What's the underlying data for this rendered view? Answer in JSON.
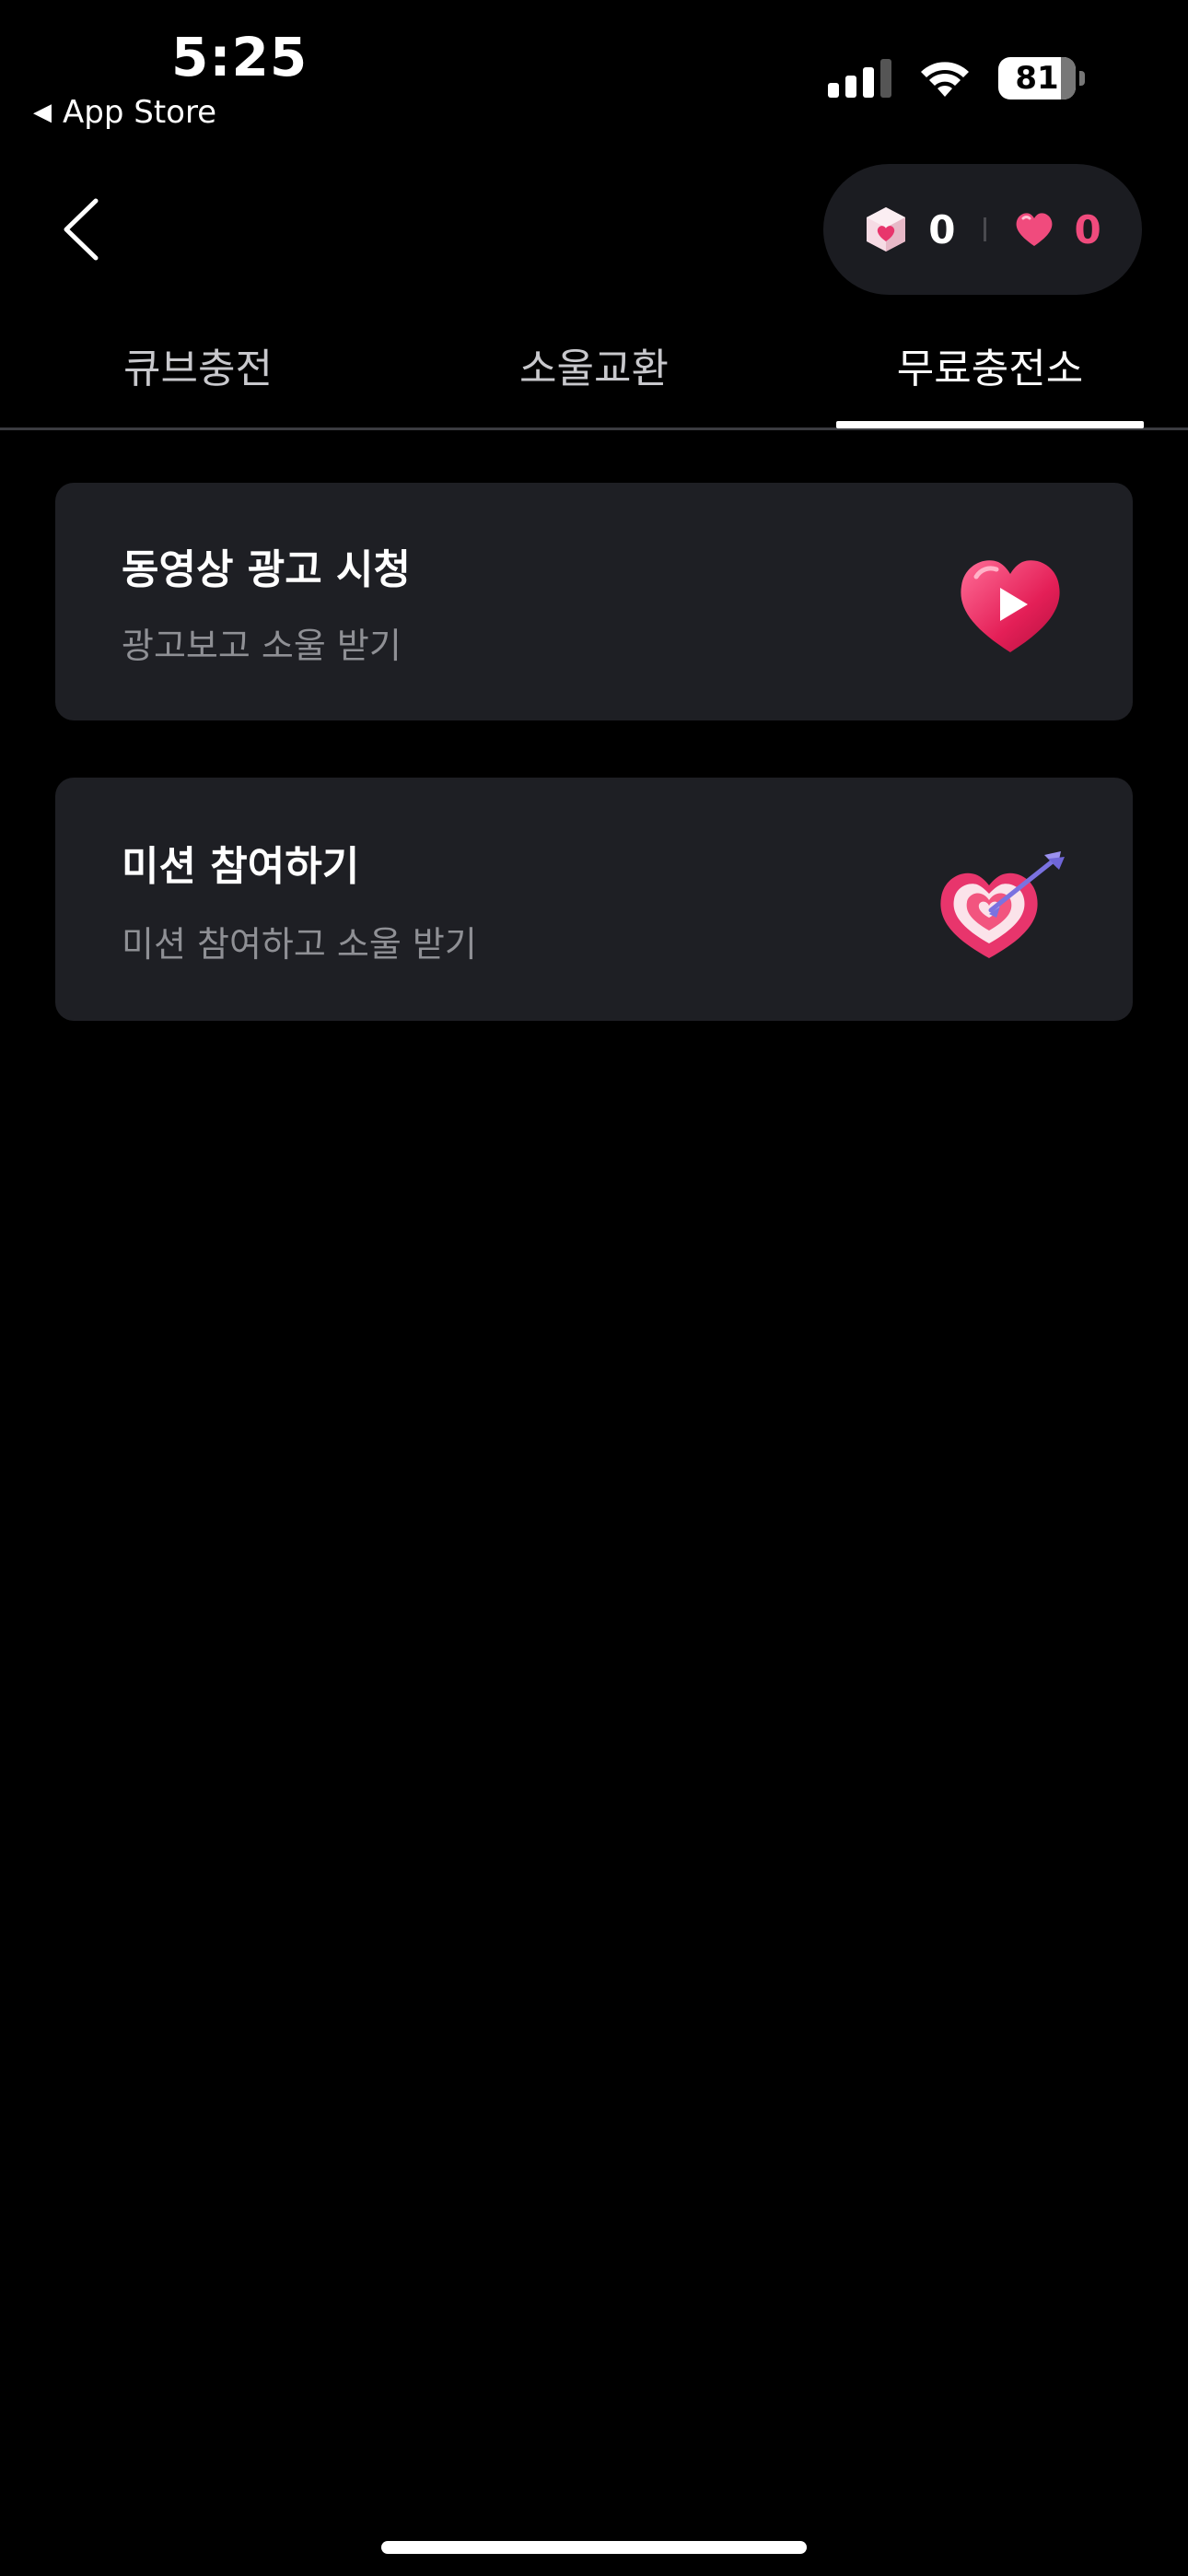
{
  "status_bar": {
    "time": "5:25",
    "back_app_label": "App Store",
    "battery_level": "81",
    "icons": [
      "cellular-signal-icon",
      "wifi-icon",
      "battery-icon"
    ]
  },
  "header": {
    "back_icon": "chevron-left-icon",
    "cube_count": "0",
    "soul_count": "0",
    "accent_color": "#f04b7d"
  },
  "tabs": [
    {
      "label": "큐브충전",
      "active": false
    },
    {
      "label": "소울교환",
      "active": false
    },
    {
      "label": "무료충전소",
      "active": true
    }
  ],
  "cards": [
    {
      "title": "동영상 광고 시청",
      "subtitle": "광고보고 소울 받기",
      "icon": "heart-play-icon"
    },
    {
      "title": "미션 참여하기",
      "subtitle": "미션 참여하고 소울 받기",
      "icon": "heart-target-icon"
    }
  ],
  "colors": {
    "background": "#000000",
    "card": "#1e1f24",
    "pill": "#1b1c21",
    "pink": "#f04b7d"
  }
}
